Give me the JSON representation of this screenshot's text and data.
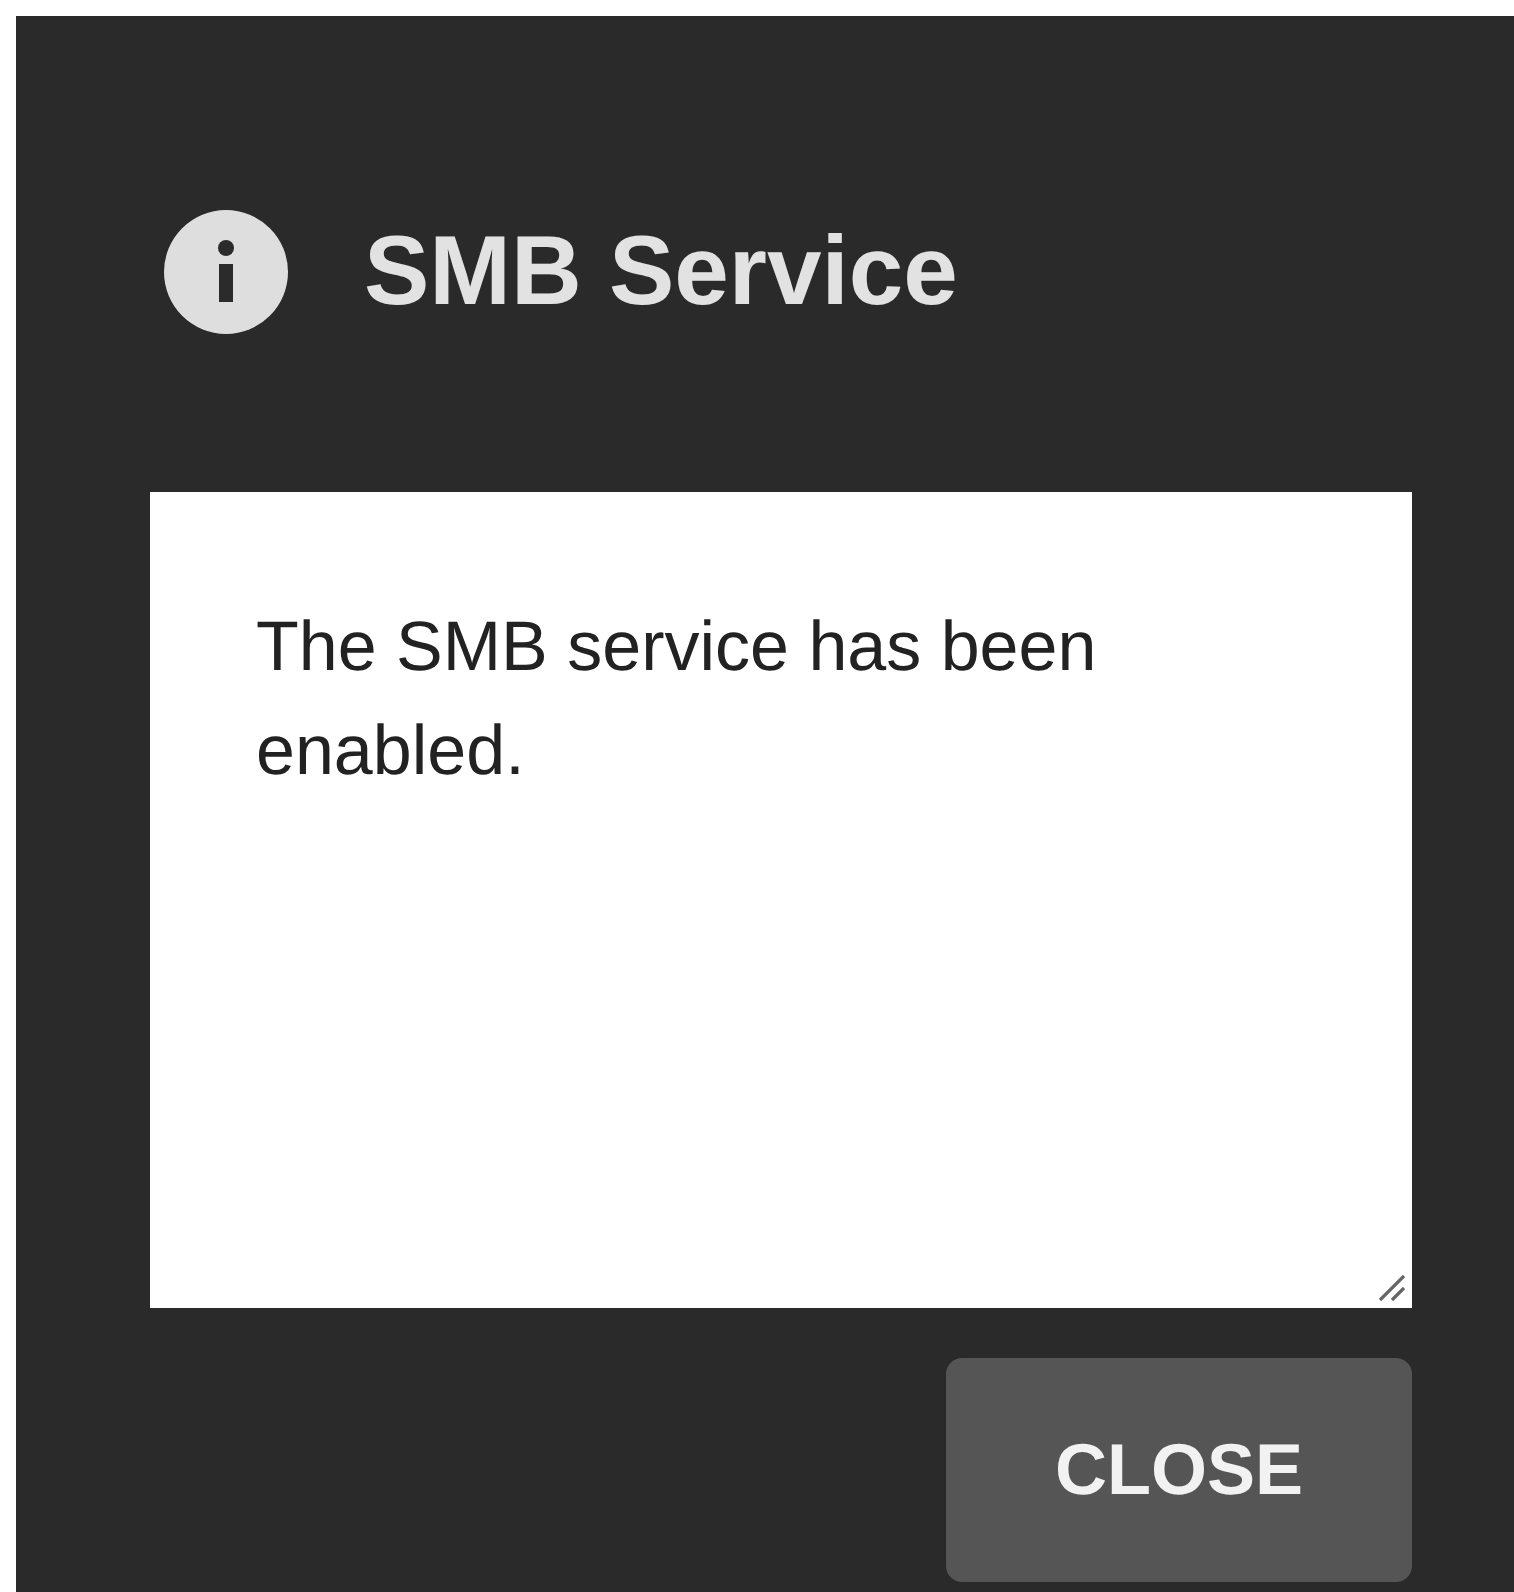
{
  "dialog": {
    "title": "SMB Service",
    "message": "The SMB service has been enabled.",
    "buttons": [
      "CLOSE"
    ]
  }
}
